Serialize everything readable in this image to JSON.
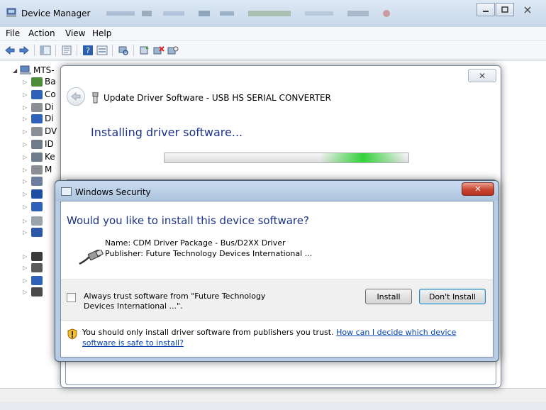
{
  "device_manager": {
    "title": "Device Manager",
    "menu": [
      "File",
      "Action",
      "View",
      "Help"
    ],
    "tree": {
      "root_label": "MTS-",
      "nodes": [
        {
          "label": "Ba",
          "color": "#4b8d3a"
        },
        {
          "label": "Co",
          "color": "#2f62b8"
        },
        {
          "label": "Di",
          "color": "#8a8f96"
        },
        {
          "label": "Di",
          "color": "#2f62b8"
        },
        {
          "label": "DV",
          "color": "#8a8f96"
        },
        {
          "label": "ID",
          "color": "#6e7b88"
        },
        {
          "label": "Ke",
          "color": "#6e7b88"
        },
        {
          "label": "M",
          "color": "#8a8f96"
        },
        {
          "label": "",
          "color": "#6d7ea0"
        },
        {
          "label": "",
          "color": "#1f4fa3"
        },
        {
          "label": "",
          "color": "#2f62b8"
        },
        {
          "label": "",
          "color": "#9aa2ab"
        },
        {
          "label": "",
          "color": "#2c56a8"
        },
        {
          "label": "",
          "color": "#3a3a3a"
        },
        {
          "label": "",
          "color": "#5a5a5a"
        },
        {
          "label": "",
          "color": "#2f62b8"
        },
        {
          "label": "",
          "color": "#4a4a4a"
        }
      ]
    }
  },
  "update_driver": {
    "title": "Update Driver Software - USB HS SERIAL CONVERTER",
    "heading": "Installing driver software...",
    "close_glyph": "✕"
  },
  "windows_security": {
    "title": "Windows Security",
    "close_glyph": "✕",
    "question": "Would you like to install this device software?",
    "name_line": "Name: CDM Driver Package - Bus/D2XX Driver",
    "publisher_line": "Publisher: Future Technology Devices International ...",
    "always_trust_label": "Always trust software from \"Future Technology Devices International ...\".",
    "always_trust_checked": false,
    "install_label": "Install",
    "dont_install_label": "Don't Install",
    "warning_text": "You should only install driver software from publishers you trust. ",
    "help_link": "How can I decide which device software is safe to install?"
  },
  "colors": {
    "heading_blue": "#1e3287",
    "link_blue": "#0645ad",
    "progress_green": "#35d13a",
    "close_red": "#c84531"
  }
}
